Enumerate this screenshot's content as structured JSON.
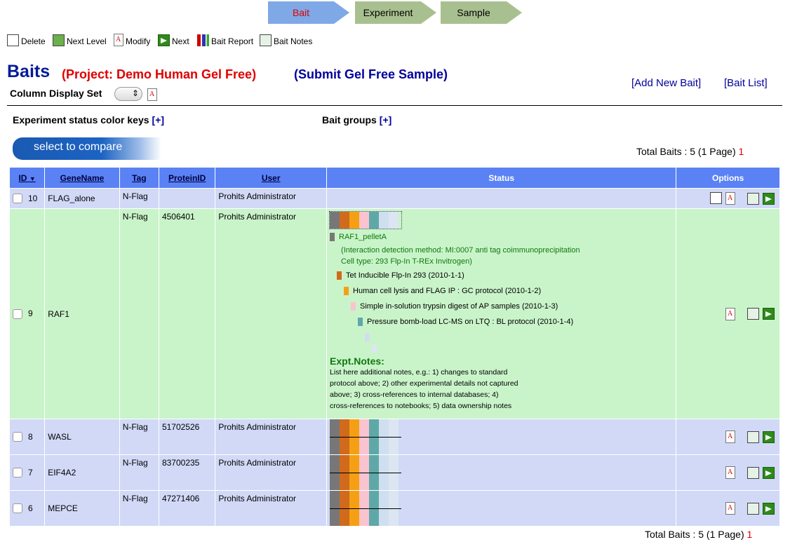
{
  "workflow": {
    "step1": "Bait",
    "step2": "Experiment",
    "step3": "Sample"
  },
  "toolbar": {
    "delete": "Delete",
    "next_level": "Next Level",
    "modify": "Modify",
    "next": "Next",
    "bait_report": "Bait Report",
    "bait_notes": "Bait Notes"
  },
  "header": {
    "title": "Baits",
    "project": "(Project: Demo Human Gel Free)",
    "submit": "(Submit Gel Free Sample)",
    "add_new": "[Add New Bait]",
    "list": "[Bait List]",
    "column_set": "Column Display Set"
  },
  "keys": {
    "status": "Experiment status color keys",
    "groups": "Bait groups",
    "plus": "[+]"
  },
  "compare": "select to compare",
  "totals": {
    "label": "Total Baits : 5 (1 Page)",
    "page": "1"
  },
  "table": {
    "headers": [
      "ID",
      "GeneName",
      "Tag",
      "ProteinID",
      "User",
      "Status",
      "Options"
    ],
    "rows": [
      {
        "id": "10",
        "gene": "FLAG_alone",
        "tag": "N-Flag",
        "protein": "",
        "user": "Prohits Administrator"
      },
      {
        "id": "9",
        "gene": "RAF1",
        "tag": "N-Flag",
        "protein": "4506401",
        "user": "Prohits Administrator"
      },
      {
        "id": "8",
        "gene": "WASL",
        "tag": "N-Flag",
        "protein": "51702526",
        "user": "Prohits Administrator"
      },
      {
        "id": "7",
        "gene": "EIF4A2",
        "tag": "N-Flag",
        "protein": "83700235",
        "user": "Prohits Administrator"
      },
      {
        "id": "6",
        "gene": "MEPCE",
        "tag": "N-Flag",
        "protein": "47271406",
        "user": "Prohits Administrator"
      }
    ]
  },
  "detail": {
    "name": "RAF1_pelletA",
    "method": "(Interaction detection method: MI:0007 anti tag coimmunoprecipitation",
    "cell": "Cell type: 293 Flp-In T-REx Invitrogen)",
    "s1": "Tet Inducible Flp-In 293 (2010-1-1)",
    "s2": "Human cell lysis and FLAG IP : GC protocol (2010-1-2)",
    "s3": "Simple in-solution trypsin digest of AP samples (2010-1-3)",
    "s4": "Pressure bomb-load LC-MS on LTQ : BL protocol (2010-1-4)",
    "notes_title": "Expt.Notes:",
    "notes1": "List here additional notes, e.g.: 1) changes to standard",
    "notes2": "protocol above; 2) other experimental details not captured",
    "notes3": "above; 3) cross-references to internal databases; 4)",
    "notes4": "cross-references to notebooks; 5) data ownership notes"
  },
  "colors": {
    "bar1": "#777777",
    "bar2": "#d06a1d",
    "bar3": "#f5a014",
    "bar4": "#f9c3cf",
    "bar5": "#5ea8a8",
    "bar6": "#cfdff0",
    "bar7": "#dbe6f2"
  }
}
